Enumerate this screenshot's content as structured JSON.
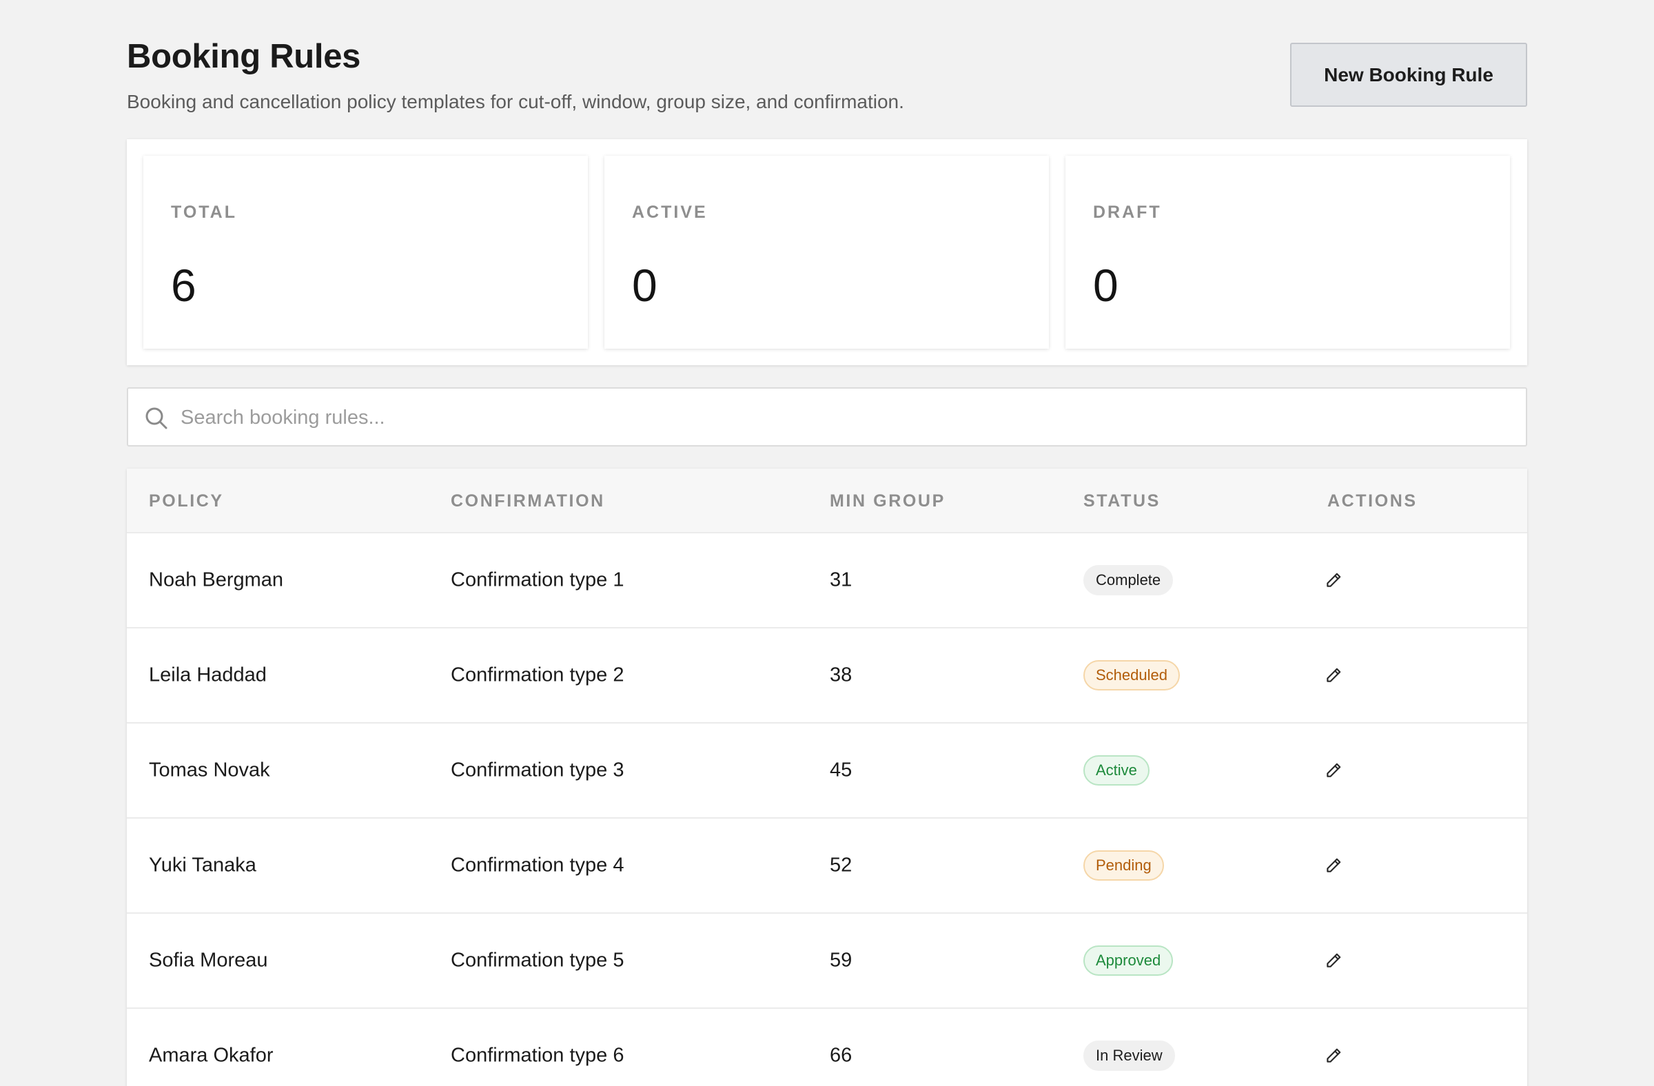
{
  "header": {
    "title": "Booking Rules",
    "subtitle": "Booking and cancellation policy templates for cut-off, window, group size, and confirmation.",
    "new_button_label": "New Booking Rule"
  },
  "stats": [
    {
      "label": "TOTAL",
      "value": "6"
    },
    {
      "label": "ACTIVE",
      "value": "0"
    },
    {
      "label": "DRAFT",
      "value": "0"
    }
  ],
  "search": {
    "placeholder": "Search booking rules...",
    "value": "",
    "icon": "search-icon"
  },
  "table": {
    "columns": [
      "POLICY",
      "CONFIRMATION",
      "MIN GROUP",
      "STATUS",
      "ACTIONS"
    ],
    "rows": [
      {
        "policy": "Noah Bergman",
        "confirmation": "Confirmation type 1",
        "min_group": "31",
        "status": "Complete",
        "status_tone": "neutral",
        "action_icon": "pencil-icon"
      },
      {
        "policy": "Leila Haddad",
        "confirmation": "Confirmation type 2",
        "min_group": "38",
        "status": "Scheduled",
        "status_tone": "warn",
        "action_icon": "pencil-icon"
      },
      {
        "policy": "Tomas Novak",
        "confirmation": "Confirmation type 3",
        "min_group": "45",
        "status": "Active",
        "status_tone": "good",
        "action_icon": "pencil-icon"
      },
      {
        "policy": "Yuki Tanaka",
        "confirmation": "Confirmation type 4",
        "min_group": "52",
        "status": "Pending",
        "status_tone": "warn",
        "action_icon": "pencil-icon"
      },
      {
        "policy": "Sofia Moreau",
        "confirmation": "Confirmation type 5",
        "min_group": "59",
        "status": "Approved",
        "status_tone": "good",
        "action_icon": "pencil-icon"
      },
      {
        "policy": "Amara Okafor",
        "confirmation": "Confirmation type 6",
        "min_group": "66",
        "status": "In Review",
        "status_tone": "neutral",
        "action_icon": "pencil-icon"
      }
    ]
  },
  "colors": {
    "background": "#f2f2f2",
    "card": "#ffffff",
    "badge_warn_text": "#b25d0a",
    "badge_good_text": "#1d8a3b"
  }
}
